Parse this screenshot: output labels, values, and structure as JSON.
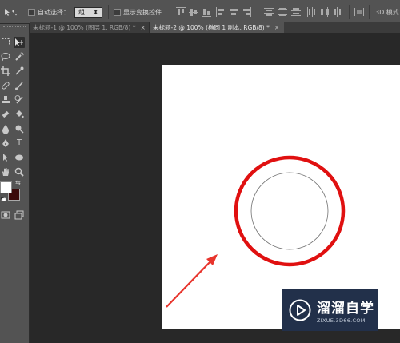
{
  "options_bar": {
    "auto_select_label": "自动选择：",
    "auto_select_value": "组",
    "show_transform_label": "显示变换控件",
    "mode_3d_label": "3D 模式："
  },
  "tabs": [
    {
      "label": "未标题-1 @ 100% (图层 1, RGB/8) *",
      "close": "×",
      "active": false
    },
    {
      "label": "未标题-2 @ 100% (椭圆 1 副本, RGB/8) *",
      "close": "×",
      "active": true
    }
  ],
  "tools": {
    "type_tool": "T"
  },
  "colors": {
    "foreground": "#ffffff",
    "background": "#3a0a0a",
    "red_ring": "#e01010",
    "arrow": "#e8342c",
    "canvas": "#ffffff",
    "workspace": "#282828"
  },
  "watermark": {
    "chinese": "溜溜自学",
    "url": "ZIXUE.3D66.COM"
  }
}
